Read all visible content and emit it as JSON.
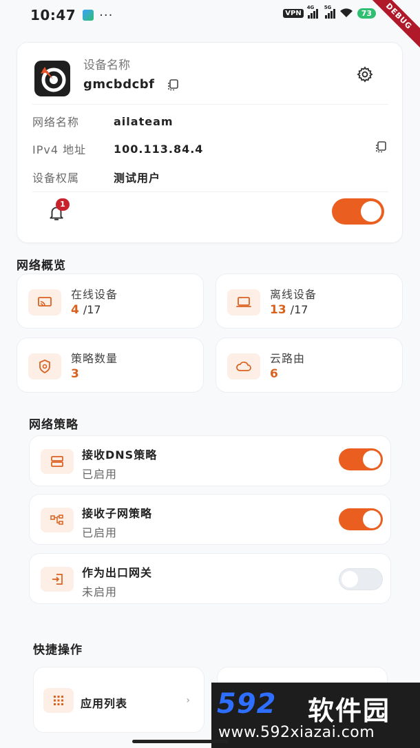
{
  "status_bar": {
    "time": "10:47",
    "dots": "···",
    "vpn": "VPN",
    "net1": "4G",
    "net2": "5G",
    "battery": "73",
    "debug": "DEBUG"
  },
  "device": {
    "label": "设备名称",
    "name": "gmcbdcbf",
    "rows": [
      {
        "key": "网络名称",
        "value": "ailateam"
      },
      {
        "key": "IPv4 地址",
        "value": "100.113.84.4"
      },
      {
        "key": "设备权属",
        "value": "测试用户"
      }
    ],
    "notification_count": "1",
    "connected": true
  },
  "overview": {
    "title": "网络概览",
    "tiles": [
      {
        "label": "在线设备",
        "value": "4",
        "total": "/17",
        "icon": "cast-icon"
      },
      {
        "label": "离线设备",
        "value": "13",
        "total": "/17",
        "icon": "laptop-icon"
      },
      {
        "label": "策略数量",
        "value": "3",
        "total": "",
        "icon": "shield-icon"
      },
      {
        "label": "云路由",
        "value": "6",
        "total": "",
        "icon": "cloud-icon"
      }
    ]
  },
  "policies": {
    "title": "网络策略",
    "items": [
      {
        "title": "接收DNS策略",
        "status": "已启用",
        "enabled": true,
        "icon": "server-icon"
      },
      {
        "title": "接收子网策略",
        "status": "已启用",
        "enabled": true,
        "icon": "network-icon"
      },
      {
        "title": "作为出口网关",
        "status": "未启用",
        "enabled": false,
        "icon": "exit-icon"
      }
    ]
  },
  "quick": {
    "title": "快捷操作",
    "items": [
      {
        "label": "应用列表",
        "icon": "grid-icon"
      }
    ]
  },
  "watermark": {
    "brand": "592",
    "brand2": "软件园",
    "url": "www.592xiazai.com"
  },
  "colors": {
    "accent": "#ea5f1f",
    "accent_text": "#d9611f",
    "icon_bg": "#fdeee6",
    "badge": "#c8222c"
  }
}
